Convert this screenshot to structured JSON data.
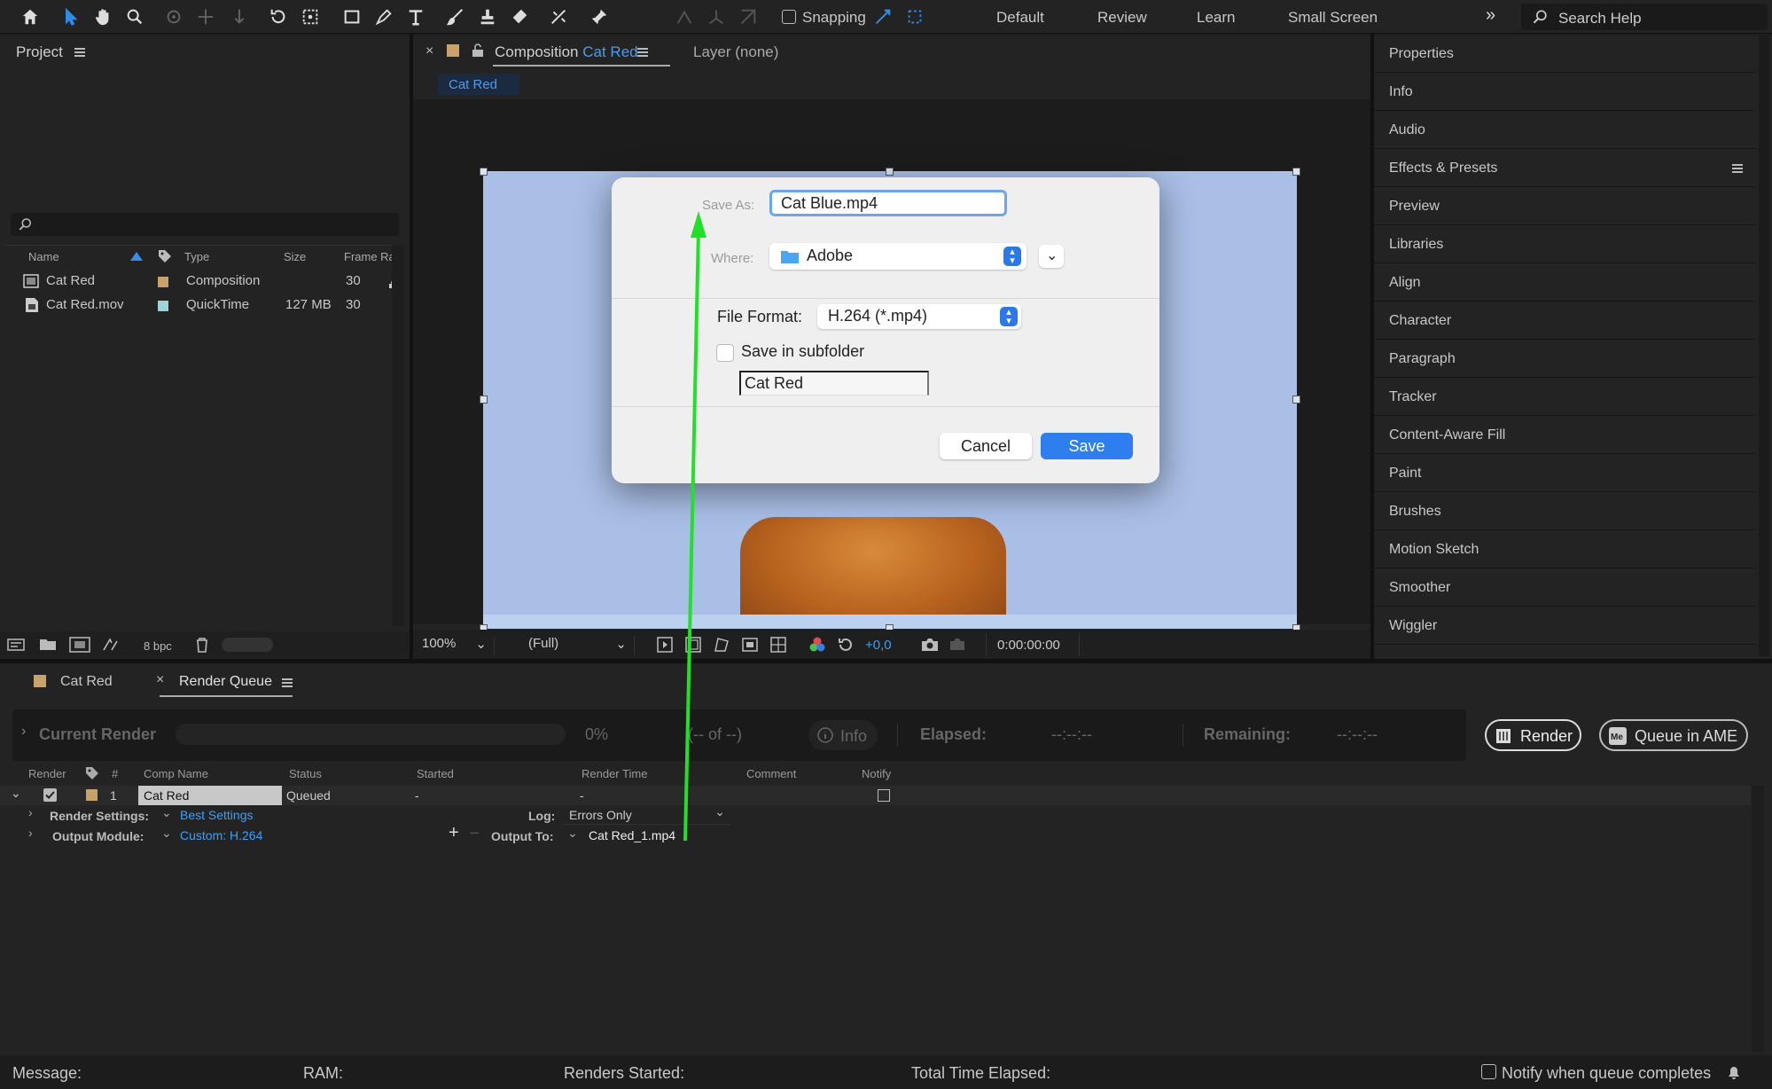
{
  "toolbar": {
    "snapping_label": "Snapping",
    "workspaces": [
      "Default",
      "Review",
      "Learn",
      "Small Screen"
    ],
    "search_placeholder": "Search Help"
  },
  "project": {
    "title": "Project",
    "columns": [
      "Name",
      "Type",
      "Size",
      "Frame Ra..."
    ],
    "items": [
      {
        "name": "Cat Red",
        "type": "Composition",
        "size": "",
        "frame_rate": "30",
        "color": "#c8a26a"
      },
      {
        "name": "Cat Red.mov",
        "type": "QuickTime",
        "size": "127 MB",
        "frame_rate": "30",
        "color": "#9fd3d8"
      }
    ],
    "bpc": "8 bpc"
  },
  "composition": {
    "tab_prefix": "Composition",
    "tab_name": "Cat Red",
    "layer_tab": "Layer (none)",
    "comp_name_tab": "Cat Red",
    "zoom": "100%",
    "resolution": "(Full)",
    "exposure": "+0,0",
    "timecode": "0:00:00:00"
  },
  "save_dialog": {
    "save_as_label": "Save As:",
    "save_as_value": "Cat Blue.mp4",
    "where_label": "Where:",
    "where_value": "Adobe",
    "file_format_label": "File Format:",
    "file_format_value": "H.264 (*.mp4)",
    "subfolder_label": "Save in subfolder",
    "subfolder_name": "Cat Red",
    "cancel_label": "Cancel",
    "save_label": "Save"
  },
  "right_panel": {
    "items": [
      "Properties",
      "Info",
      "Audio",
      "Effects & Presets",
      "Preview",
      "Libraries",
      "Align",
      "Character",
      "Paragraph",
      "Tracker",
      "Content-Aware Fill",
      "Paint",
      "Brushes",
      "Motion Sketch",
      "Smoother",
      "Wiggler"
    ]
  },
  "render_queue": {
    "tab_comp": "Cat Red",
    "tab_rq": "Render Queue",
    "current_render_label": "Current Render",
    "progress": "0%",
    "of_text": "(-- of --)",
    "info_label": "Info",
    "elapsed_label": "Elapsed:",
    "elapsed_value": "--:--:--",
    "remaining_label": "Remaining:",
    "remaining_value": "--:--:--",
    "render_button": "Render",
    "ame_button": "Queue in AME",
    "columns": [
      "Render",
      "#",
      "Comp Name",
      "Status",
      "Started",
      "Render Time",
      "Comment",
      "Notify"
    ],
    "row": {
      "number": "1",
      "comp_name": "Cat Red",
      "status": "Queued",
      "started": "-",
      "render_time": "-"
    },
    "render_settings_label": "Render Settings:",
    "render_settings_value": "Best Settings",
    "log_label": "Log:",
    "log_value": "Errors Only",
    "output_module_label": "Output Module:",
    "output_module_value": "Custom: H.264",
    "output_to_label": "Output To:",
    "output_to_value": "Cat Red_1.mp4"
  },
  "status_bar": {
    "message": "Message:",
    "ram": "RAM:",
    "renders_started": "Renders Started:",
    "total_time": "Total Time Elapsed:",
    "notify_label": "Notify when queue completes"
  }
}
